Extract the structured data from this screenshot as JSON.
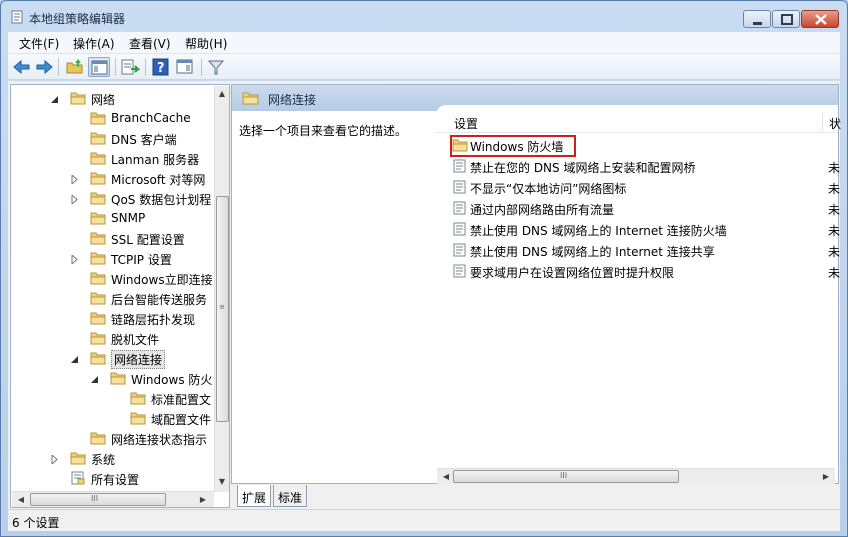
{
  "window": {
    "title": "本地组策略编辑器"
  },
  "menu": [
    {
      "label": "文件(F)"
    },
    {
      "label": "操作(A)"
    },
    {
      "label": "查看(V)"
    },
    {
      "label": "帮助(H)"
    }
  ],
  "tree": {
    "items": [
      {
        "label": "网络",
        "expander": "expanded"
      },
      {
        "label": "BranchCache",
        "expander": "none"
      },
      {
        "label": "DNS 客户端",
        "expander": "none"
      },
      {
        "label": "Lanman 服务器",
        "expander": "none"
      },
      {
        "label": "Microsoft 对等网",
        "expander": "collapsed"
      },
      {
        "label": "QoS 数据包计划程",
        "expander": "collapsed"
      },
      {
        "label": "SNMP",
        "expander": "none"
      },
      {
        "label": "SSL 配置设置",
        "expander": "none"
      },
      {
        "label": "TCPIP 设置",
        "expander": "collapsed"
      },
      {
        "label": "Windows立即连接",
        "expander": "none"
      },
      {
        "label": "后台智能传送服务",
        "expander": "none"
      },
      {
        "label": "链路层拓扑发现",
        "expander": "none"
      },
      {
        "label": "脱机文件",
        "expander": "none"
      },
      {
        "label": "网络连接",
        "expander": "expanded"
      },
      {
        "label": "Windows 防火",
        "expander": "expanded"
      },
      {
        "label": "标准配置文",
        "expander": "none"
      },
      {
        "label": "域配置文件",
        "expander": "none"
      },
      {
        "label": "网络连接状态指示",
        "expander": "none"
      },
      {
        "label": "系统",
        "expander": "collapsed"
      },
      {
        "label": "所有设置",
        "expander": "none"
      }
    ]
  },
  "right_pane": {
    "header_title": "网络连接",
    "description": "选择一个项目来查看它的描述。",
    "column_setting": "设置",
    "column_state": "状",
    "rows": [
      {
        "label": "Windows 防火墙",
        "type": "folder",
        "state": ""
      },
      {
        "label": "禁止在您的 DNS 域网络上安装和配置网桥",
        "type": "policy",
        "state": "未"
      },
      {
        "label": "不显示“仅本地访问”网络图标",
        "type": "policy",
        "state": "未"
      },
      {
        "label": "通过内部网络路由所有流量",
        "type": "policy",
        "state": "未"
      },
      {
        "label": "禁止使用 DNS 域网络上的 Internet 连接防火墙",
        "type": "policy",
        "state": "未"
      },
      {
        "label": "禁止使用 DNS 域网络上的 Internet 连接共享",
        "type": "policy",
        "state": "未"
      },
      {
        "label": "要求域用户在设置网络位置时提升权限",
        "type": "policy",
        "state": "未"
      }
    ]
  },
  "tabs": [
    {
      "label": "扩展"
    },
    {
      "label": "标准"
    }
  ],
  "status": {
    "text": "6 个设置"
  },
  "scrollbar_grip": "III"
}
